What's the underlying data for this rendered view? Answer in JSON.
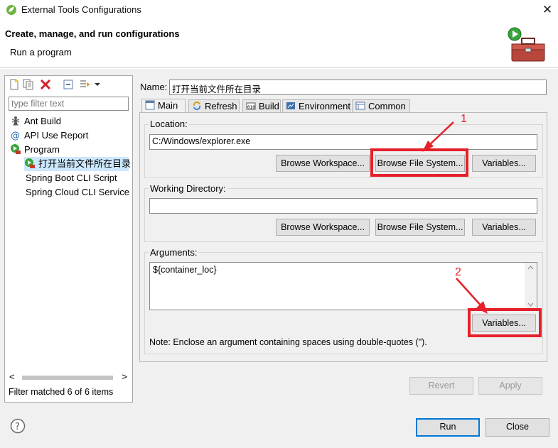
{
  "window": {
    "title": "External Tools Configurations",
    "close_glyph": "✕"
  },
  "header": {
    "title": "Create, manage, and run configurations",
    "subtitle": "Run a program",
    "banner_icon": "toolbox-run-icon"
  },
  "left_panel": {
    "toolbar_icons": [
      "new-config-icon",
      "duplicate-icon",
      "delete-icon",
      "collapse-all-icon",
      "filter-icon",
      "dropdown-arrow-icon"
    ],
    "filter_placeholder": "type filter text",
    "tree": [
      {
        "label": "Ant Build",
        "icon": "ant-icon",
        "level": 0
      },
      {
        "label": "API Use Report",
        "icon": "api-report-icon",
        "level": 0
      },
      {
        "label": "Program",
        "icon": "program-icon",
        "level": 0
      },
      {
        "label": "打开当前文件所在目录",
        "icon": "program-run-icon",
        "level": 1,
        "selected": true
      },
      {
        "label": "Spring Boot CLI Script",
        "icon": "",
        "level": 0
      },
      {
        "label": "Spring Cloud CLI Service",
        "icon": "",
        "level": 0
      }
    ],
    "scroll_left": "<",
    "scroll_right": ">",
    "status": "Filter matched 6 of 6 items"
  },
  "config": {
    "name_label": "Name:",
    "name_value": "打开当前文件所在目录",
    "tabs": [
      {
        "label": "Main",
        "icon": "main-tab-icon",
        "active": true
      },
      {
        "label": "Refresh",
        "icon": "refresh-icon"
      },
      {
        "label": "Build",
        "icon": "build-icon"
      },
      {
        "label": "Environment",
        "icon": "environment-icon"
      },
      {
        "label": "Common",
        "icon": "common-icon"
      }
    ],
    "location": {
      "label": "Location:",
      "value": "C:/Windows/explorer.exe",
      "browse_workspace": "Browse Workspace...",
      "browse_file_system": "Browse File System...",
      "variables": "Variables..."
    },
    "working_dir": {
      "label": "Working Directory:",
      "value": "",
      "browse_workspace": "Browse Workspace...",
      "browse_file_system": "Browse File System...",
      "variables": "Variables..."
    },
    "arguments": {
      "label": "Arguments:",
      "value": "${container_loc}",
      "variables": "Variables...",
      "note": "Note: Enclose an argument containing spaces using double-quotes (\")."
    },
    "revert": "Revert",
    "apply": "Apply"
  },
  "annotations": [
    {
      "number": "1",
      "color": "#e6202a"
    },
    {
      "number": "2",
      "color": "#e6202a"
    }
  ],
  "footer": {
    "help_glyph": "?",
    "run": "Run",
    "close": "Close"
  }
}
